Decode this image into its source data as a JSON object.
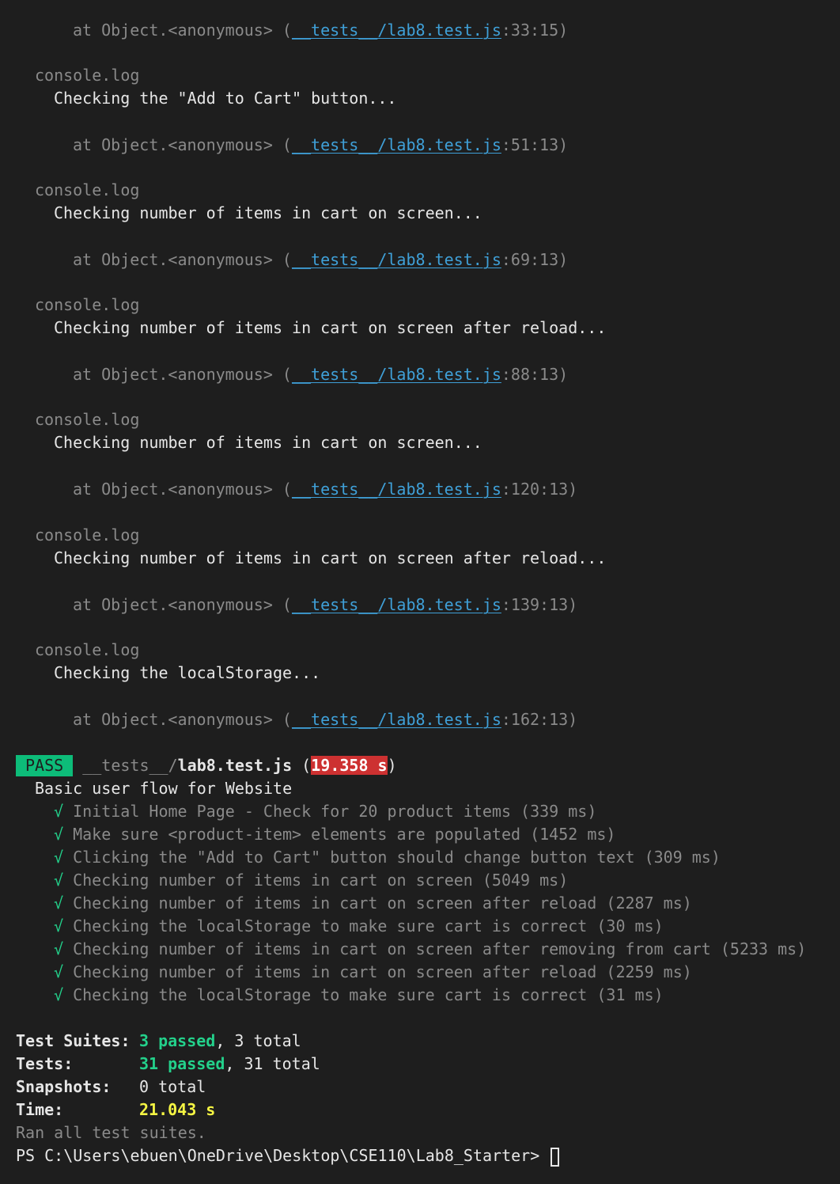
{
  "log_blocks": [
    {
      "at_prefix": "at Object.<anonymous> (",
      "file": "__tests__/lab8.test.js",
      "loc": ":33:15)"
    },
    {
      "label": "console.log",
      "message": "Checking the \"Add to Cart\" button...",
      "at_prefix": "at Object.<anonymous> (",
      "file": "__tests__/lab8.test.js",
      "loc": ":51:13)"
    },
    {
      "label": "console.log",
      "message": "Checking number of items in cart on screen...",
      "at_prefix": "at Object.<anonymous> (",
      "file": "__tests__/lab8.test.js",
      "loc": ":69:13)"
    },
    {
      "label": "console.log",
      "message": "Checking number of items in cart on screen after reload...",
      "at_prefix": "at Object.<anonymous> (",
      "file": "__tests__/lab8.test.js",
      "loc": ":88:13)"
    },
    {
      "label": "console.log",
      "message": "Checking number of items in cart on screen...",
      "at_prefix": "at Object.<anonymous> (",
      "file": "__tests__/lab8.test.js",
      "loc": ":120:13)"
    },
    {
      "label": "console.log",
      "message": "Checking number of items in cart on screen after reload...",
      "at_prefix": "at Object.<anonymous> (",
      "file": "__tests__/lab8.test.js",
      "loc": ":139:13)"
    },
    {
      "label": "console.log",
      "message": "Checking the localStorage...",
      "at_prefix": "at Object.<anonymous> (",
      "file": "__tests__/lab8.test.js",
      "loc": ":162:13)"
    }
  ],
  "result": {
    "status": "PASS",
    "dir": "__tests__/",
    "file": "lab8.test.js",
    "open_paren": " (",
    "duration": "19.358 s",
    "close_paren": ")",
    "suite_name": "Basic user flow for Website",
    "check_glyph": "√",
    "tests": [
      {
        "name": "Initial Home Page - Check for 20 product items",
        "time": "(339 ms)"
      },
      {
        "name": "Make sure <product-item> elements are populated",
        "time": "(1452 ms)"
      },
      {
        "name": "Clicking the \"Add to Cart\" button should change button text",
        "time": "(309 ms)"
      },
      {
        "name": "Checking number of items in cart on screen",
        "time": "(5049 ms)"
      },
      {
        "name": "Checking number of items in cart on screen after reload",
        "time": "(2287 ms)"
      },
      {
        "name": "Checking the localStorage to make sure cart is correct",
        "time": "(30 ms)"
      },
      {
        "name": "Checking number of items in cart on screen after removing from cart",
        "time": "(5233 ms)"
      },
      {
        "name": "Checking number of items in cart on screen after reload",
        "time": "(2259 ms)"
      },
      {
        "name": "Checking the localStorage to make sure cart is correct",
        "time": "(31 ms)"
      }
    ]
  },
  "summary": {
    "suites_label": "Test Suites:",
    "suites_passed": "3 passed",
    "suites_total": ", 3 total",
    "tests_label": "Tests:",
    "tests_passed": "31 passed",
    "tests_total": ", 31 total",
    "snapshots_label": "Snapshots:",
    "snapshots_value": "0 total",
    "time_label": "Time:",
    "time_value": "21.043 s",
    "ran_all": "Ran all test suites."
  },
  "prompt": {
    "text": "PS C:\\Users\\ebuen\\OneDrive\\Desktop\\CSE110\\Lab8_Starter> "
  },
  "colors": {
    "background": "#1e1e1e",
    "link": "#3fa0d8",
    "pass_green": "#23d18b",
    "pass_badge": "#0dbc79",
    "slow_red": "#cd3131",
    "time_yellow": "#f5f543"
  }
}
